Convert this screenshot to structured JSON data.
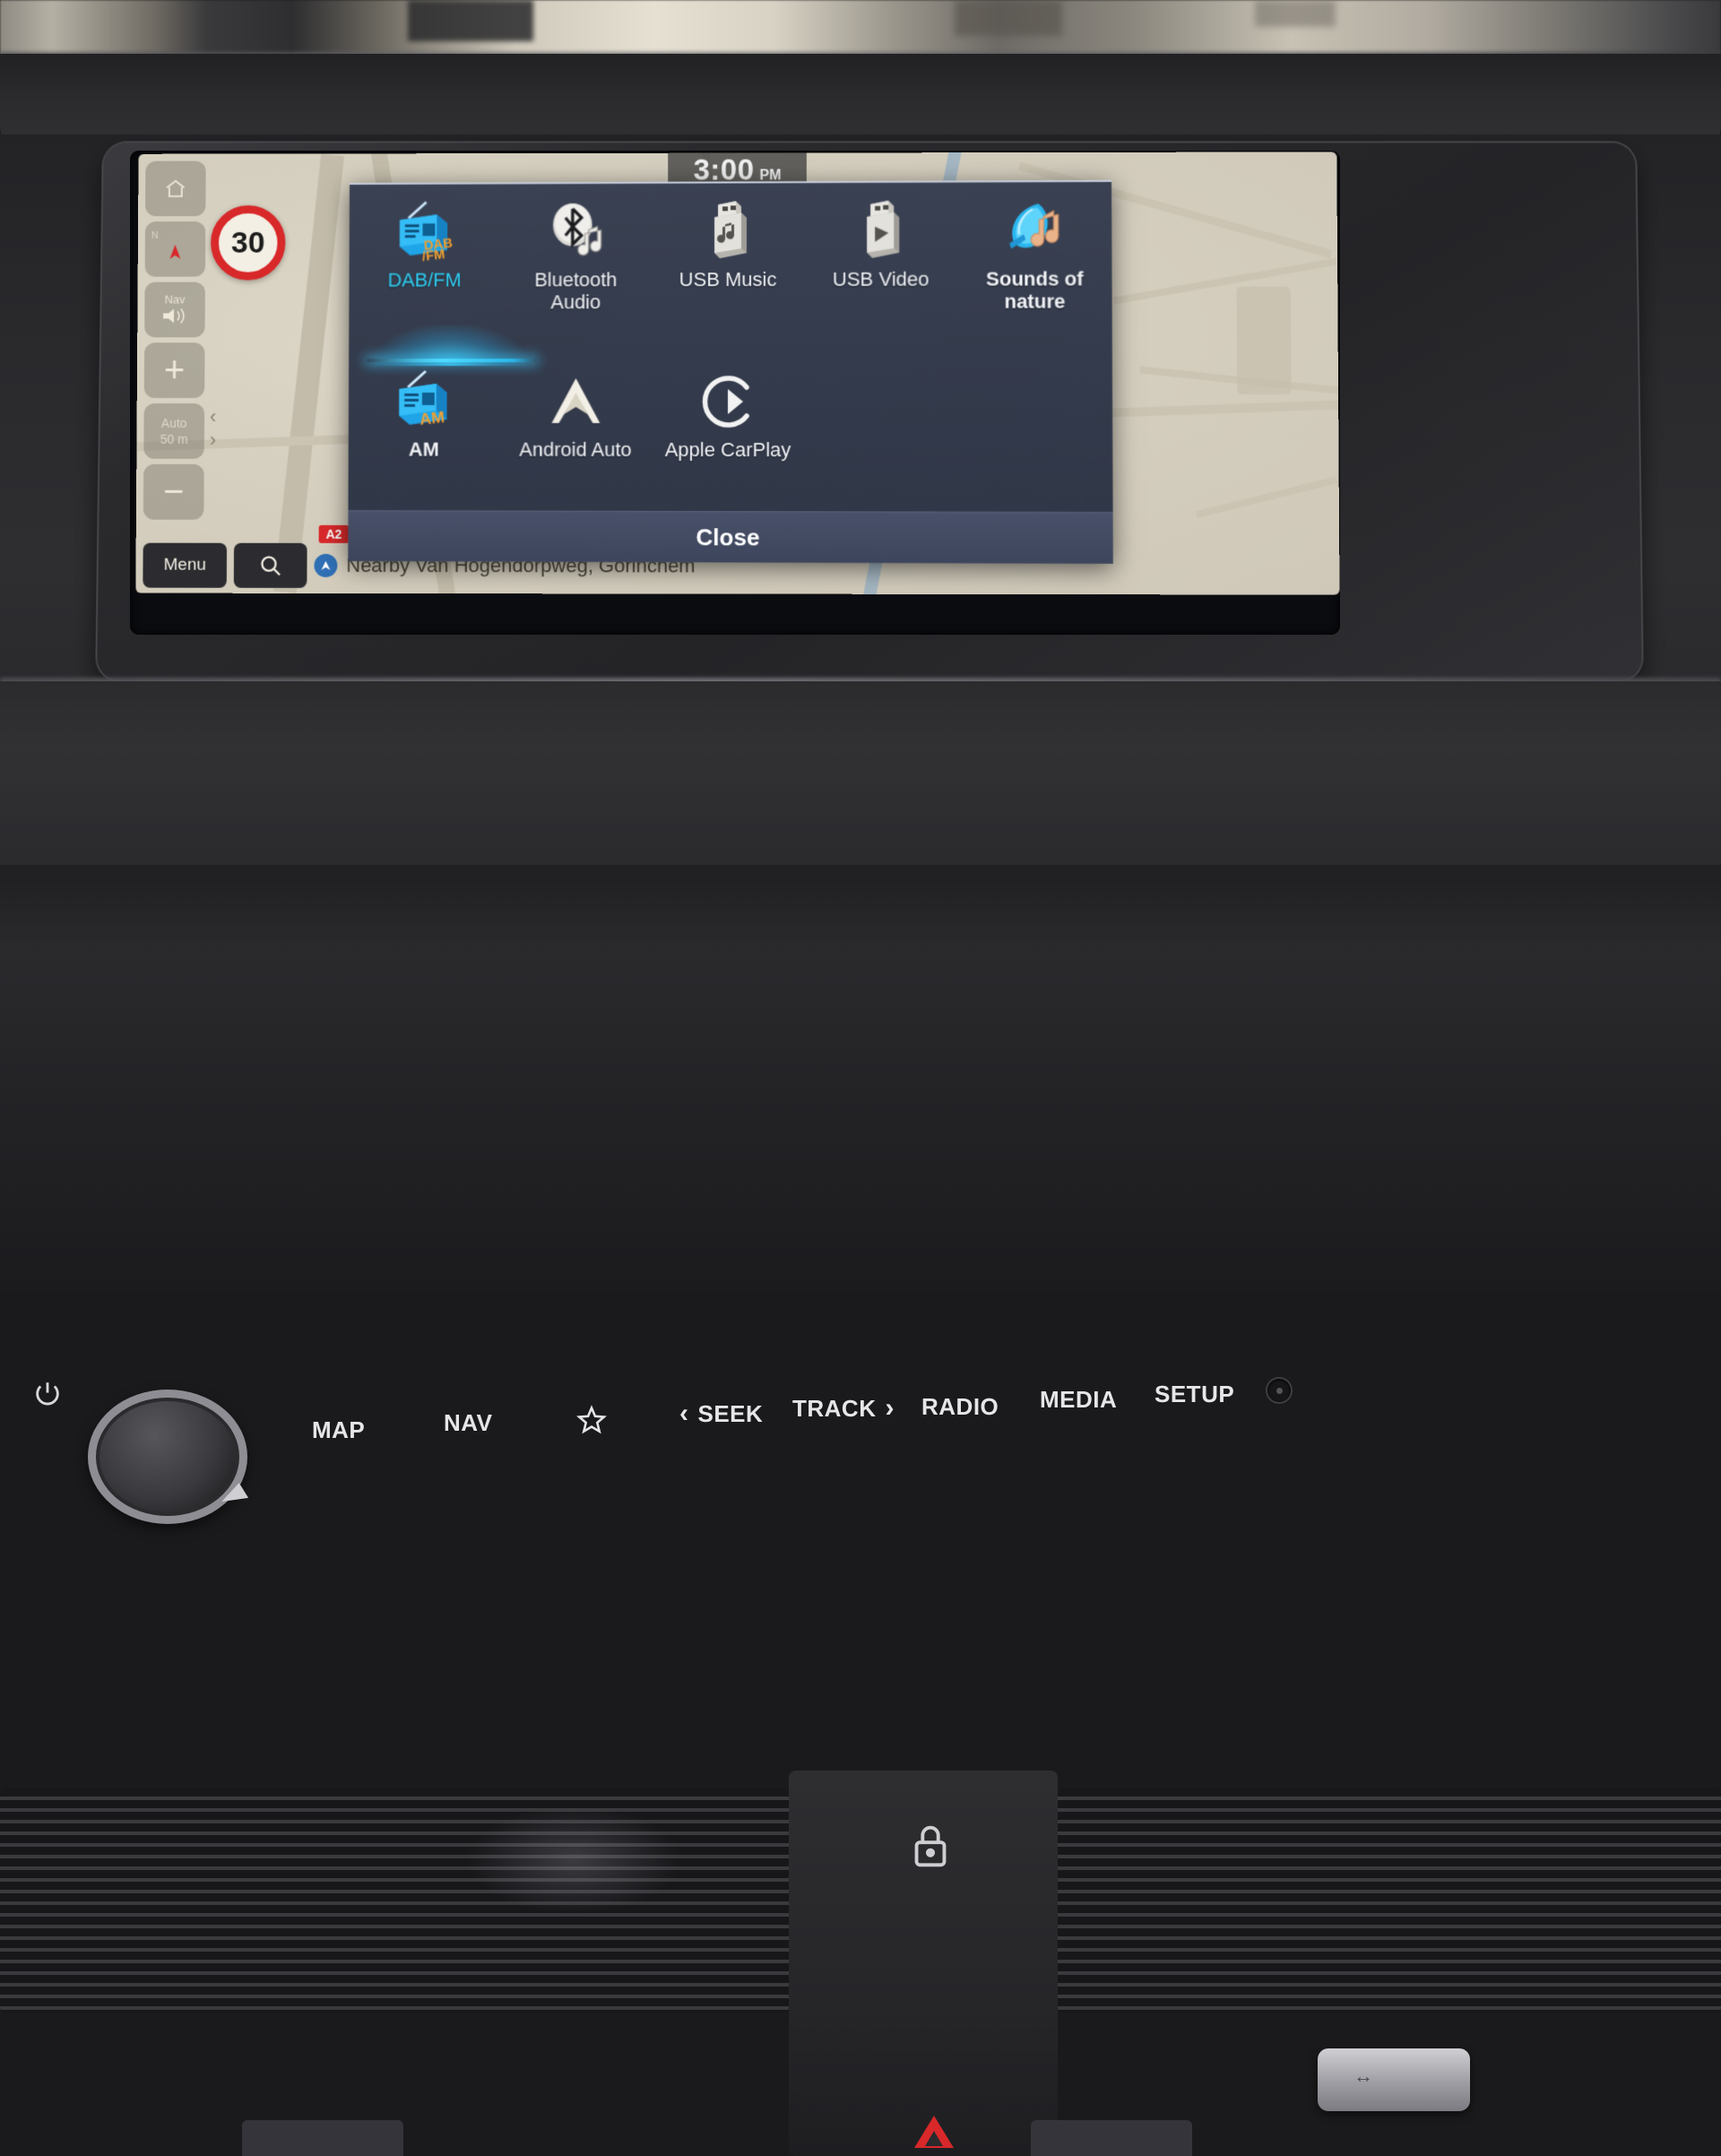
{
  "screen": {
    "clock": {
      "time": "3:00",
      "ampm": "PM"
    },
    "map": {
      "speed_limit": "30",
      "road_badge": "A2",
      "nearby_label": "Nearby Van Hogendorpweg, Gorinchem",
      "rail": {
        "home_icon": "home-icon",
        "compass_label": "N",
        "nav_label": "Nav",
        "nav_icon": "volume-icon",
        "zoom_in": "+",
        "zoom_out": "−",
        "scale_mode": "Auto",
        "scale_value": "50 m",
        "arrow_left": "‹",
        "arrow_right": "›"
      },
      "menu_label": "Menu",
      "search_icon": "search-icon"
    },
    "dialog": {
      "title": "",
      "close_label": "Close",
      "rows": [
        [
          {
            "label": "DAB/FM",
            "icon": "radio-dabfm-icon",
            "selected": true,
            "bold": false
          },
          {
            "label": "Bluetooth\nAudio",
            "icon": "bluetooth-audio-icon",
            "selected": false,
            "bold": false
          },
          {
            "label": "USB Music",
            "icon": "usb-music-icon",
            "selected": false,
            "bold": false
          },
          {
            "label": "USB Video",
            "icon": "usb-video-icon",
            "selected": false,
            "bold": false
          },
          {
            "label": "Sounds of\nnature",
            "icon": "sounds-of-nature-icon",
            "selected": false,
            "bold": true
          }
        ],
        [
          {
            "label": "AM",
            "icon": "radio-am-icon",
            "selected": false,
            "bold": true
          },
          {
            "label": "Android Auto",
            "icon": "android-auto-icon",
            "selected": false,
            "bold": false
          },
          {
            "label": "Apple CarPlay",
            "icon": "apple-carplay-icon",
            "selected": false,
            "bold": false
          }
        ]
      ],
      "labels": {
        "dabfm": "DAB/FM",
        "bluetooth_line1": "Bluetooth",
        "bluetooth_line2": "Audio",
        "usb_music": "USB Music",
        "usb_video": "USB Video",
        "nature_line1": "Sounds of",
        "nature_line2": "nature",
        "am": "AM",
        "android_auto": "Android Auto",
        "apple_carplay": "Apple CarPlay"
      }
    },
    "colors": {
      "dialog_bg": "#343b4c",
      "selected_text": "#2fd0f5",
      "accent_glow": "#4fdcff",
      "close_bar": "#49516a",
      "map_bg": "#d6d0c0",
      "speed_sign_red": "#d8282a"
    }
  },
  "hardware": {
    "power_icon": "power-icon",
    "volume_knob": "volume-knob",
    "buttons": [
      {
        "label": "MAP",
        "name": "map-button"
      },
      {
        "label": "NAV",
        "name": "nav-button"
      },
      {
        "label": "RADIO",
        "name": "radio-button"
      },
      {
        "label": "MEDIA",
        "name": "media-button"
      },
      {
        "label": "SETUP",
        "name": "setup-button"
      }
    ],
    "favorite_icon": "star-icon",
    "seek_label": "SEEK",
    "track_label": "TRACK",
    "seek_chevron": "‹",
    "track_chevron": "›",
    "reset_hole": "reset-pinhole"
  },
  "console": {
    "lock_icon": "lock-icon",
    "hazard_icon": "hazard-triangle-icon",
    "key_fob": "key-fob"
  }
}
